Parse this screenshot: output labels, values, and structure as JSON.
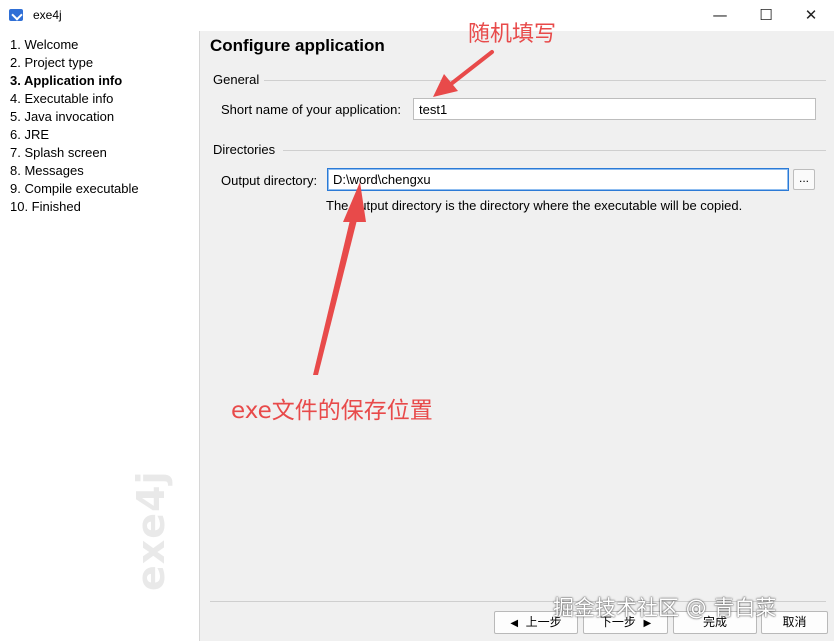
{
  "window": {
    "title": "exe4j",
    "controls": {
      "minimize": "—",
      "maximize": "☐",
      "close": "✕"
    }
  },
  "sidebar": {
    "steps": [
      {
        "label": "1. Welcome",
        "active": false
      },
      {
        "label": "2. Project type",
        "active": false
      },
      {
        "label": "3. Application info",
        "active": true
      },
      {
        "label": "4. Executable info",
        "active": false
      },
      {
        "label": "5. Java invocation",
        "active": false
      },
      {
        "label": "6. JRE",
        "active": false
      },
      {
        "label": "7. Splash screen",
        "active": false
      },
      {
        "label": "8. Messages",
        "active": false
      },
      {
        "label": "9. Compile executable",
        "active": false
      },
      {
        "label": "10. Finished",
        "active": false
      }
    ],
    "watermark": "exe4j"
  },
  "main": {
    "heading": "Configure application",
    "general": {
      "section_label": "General",
      "short_name_label": "Short name of your application:",
      "short_name_value": "test1"
    },
    "directories": {
      "section_label": "Directories",
      "output_label": "Output directory:",
      "output_value": "D:\\word\\chengxu",
      "browse_label": "...",
      "help_text": "The output directory is the directory where the executable will be copied."
    }
  },
  "footer": {
    "back_label": "上一步",
    "next_label": "下一步",
    "finish_label": "完成",
    "cancel_label": "取消"
  },
  "annotations": {
    "top_note": "随机填写",
    "middle_note": "exe文件的保存位置",
    "credit": "掘金技术社区 @ 青白菜",
    "color": "#e84a4a"
  }
}
